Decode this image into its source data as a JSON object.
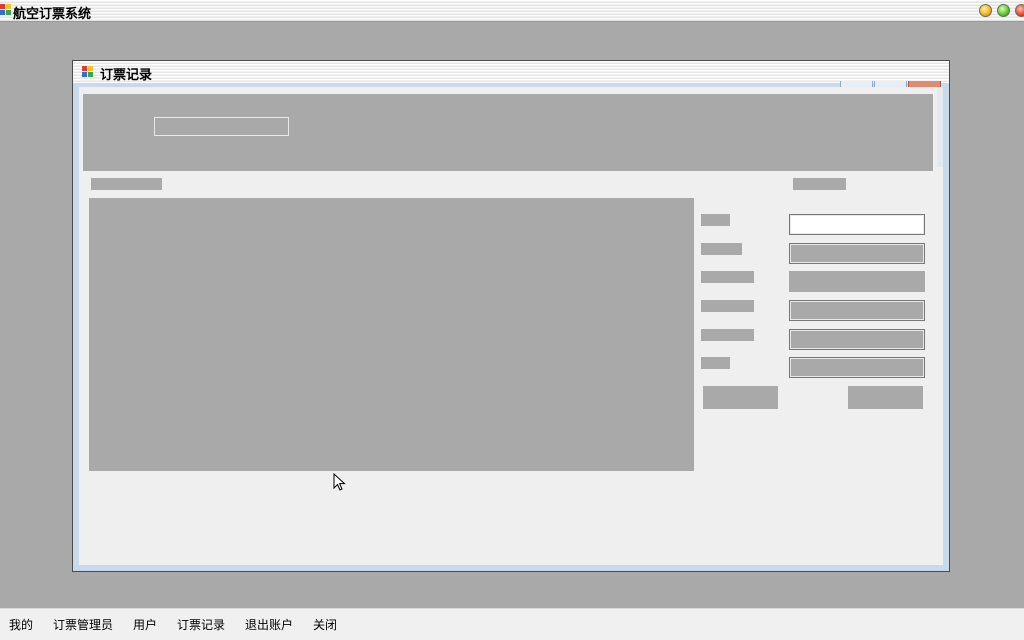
{
  "app": {
    "title": "航空订票系统"
  },
  "child_window": {
    "title": "订票记录"
  },
  "menubar": {
    "items": [
      {
        "label": "我的"
      },
      {
        "label": "订票管理员"
      },
      {
        "label": "用户"
      },
      {
        "label": "订票记录"
      },
      {
        "label": "退出账户"
      },
      {
        "label": "关闭"
      }
    ]
  },
  "colors": {
    "desktop": "#a9a9a9",
    "client": "#efefef",
    "frame": "#c9d9ec",
    "placeholder": "#a9a9a9"
  },
  "icons": [
    "app-icon",
    "child-window-icon",
    "minimize-icon",
    "maximize-icon",
    "close-icon",
    "mouse-cursor-icon"
  ]
}
